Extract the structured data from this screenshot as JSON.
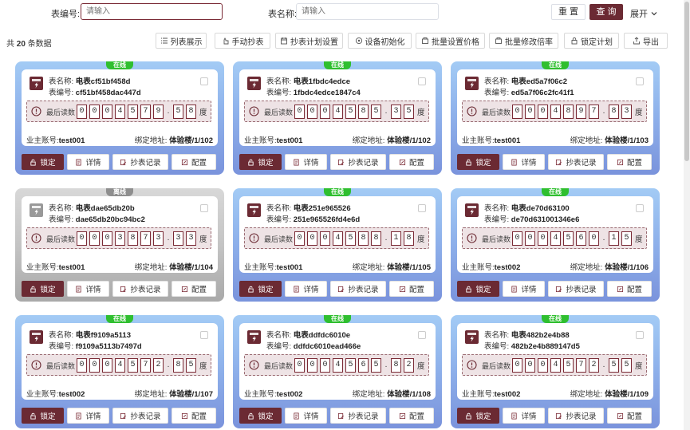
{
  "search": {
    "meter_no_label": "表编号:",
    "meter_no_placeholder": "请输入",
    "meter_name_label": "表名称:",
    "meter_name_placeholder": "请输入",
    "reset_label": "重 置",
    "query_label": "查 询",
    "expand_label": "展开"
  },
  "toolbar": {
    "count_prefix": "共",
    "count": "20",
    "count_suffix": "条数据",
    "buttons": [
      {
        "label": "列表展示",
        "icon": "list-icon"
      },
      {
        "label": "手动抄表",
        "icon": "hand-icon"
      },
      {
        "label": "抄表计划设置",
        "icon": "calendar-icon"
      },
      {
        "label": "设备初始化",
        "icon": "refresh-icon"
      },
      {
        "label": "批量设置价格",
        "icon": "tag-icon"
      },
      {
        "label": "批量修改倍率",
        "icon": "tag-icon"
      },
      {
        "label": "锁定计划",
        "icon": "lock-icon"
      },
      {
        "label": "导出",
        "icon": "export-icon"
      }
    ]
  },
  "card_labels": {
    "name_label": "表名称:",
    "no_label": "表编号:",
    "reading_label": "最后读数",
    "unit": "度",
    "owner_label": "业主账号:",
    "addr_label": "绑定地址:",
    "lock": "锁定",
    "detail": "详情",
    "record": "抄表记录",
    "config": "配置"
  },
  "cards": [
    {
      "status": "在线",
      "online": true,
      "name": "电表cf51bf458d",
      "no": "cf51bf458dac447d",
      "reading": "0004579.58",
      "owner": "test001",
      "addr": "体验楼/1/102"
    },
    {
      "status": "在线",
      "online": true,
      "name": "电表1fbdc4edce",
      "no": "1fbdc4edce1847c4",
      "reading": "0004585.35",
      "owner": "test001",
      "addr": "体验楼/1/102"
    },
    {
      "status": "在线",
      "online": true,
      "name": "电表ed5a7f06c2",
      "no": "ed5a7f06c2fc41f1",
      "reading": "0004897.83",
      "owner": "test001",
      "addr": "体验楼/1/103"
    },
    {
      "status": "离线",
      "online": false,
      "name": "电表dae65db20b",
      "no": "dae65db20bc94bc2",
      "reading": "0003873.33",
      "owner": "test001",
      "addr": "体验楼/1/104"
    },
    {
      "status": "在线",
      "online": true,
      "name": "电表251e965526",
      "no": "251e965526fd4e6d",
      "reading": "0004588.18",
      "owner": "test001",
      "addr": "体验楼/1/105"
    },
    {
      "status": "在线",
      "online": true,
      "name": "电表de70d63100",
      "no": "de70d631001346e6",
      "reading": "0004560.15",
      "owner": "test002",
      "addr": "体验楼/1/106"
    },
    {
      "status": "在线",
      "online": true,
      "name": "电表f9109a5113",
      "no": "f9109a5113b7497d",
      "reading": "0004572.85",
      "owner": "test002",
      "addr": "体验楼/1/107"
    },
    {
      "status": "在线",
      "online": true,
      "name": "电表ddfdc6010e",
      "no": "ddfdc6010ead466e",
      "reading": "0004565.82",
      "owner": "test002",
      "addr": "体验楼/1/108"
    },
    {
      "status": "在线",
      "online": true,
      "name": "电表482b2e4b88",
      "no": "482b2e4b889147d5",
      "reading": "0004572.55",
      "owner": "test002",
      "addr": "体验楼/1/109"
    }
  ]
}
